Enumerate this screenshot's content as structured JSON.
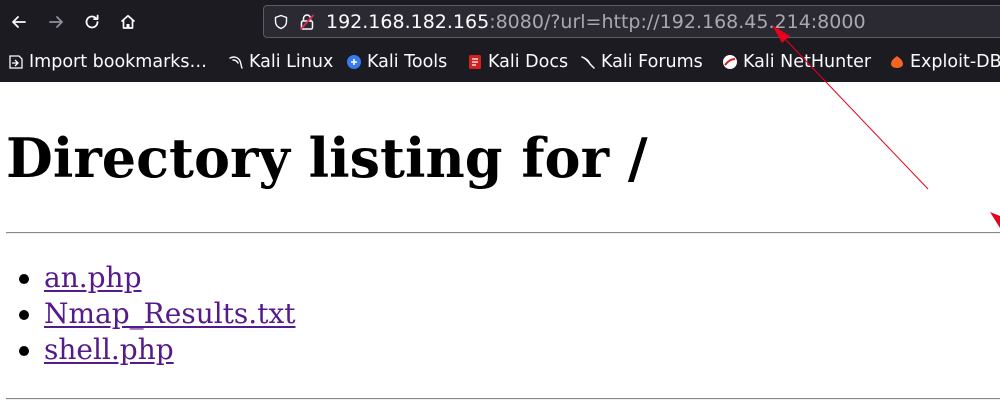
{
  "browser": {
    "url": {
      "host": "192.168.182.165",
      "rest": ":8080/?url=http://192.168.45.214:8000"
    },
    "bookmarks": [
      {
        "label": "Import bookmarks…",
        "icon": "import-icon"
      },
      {
        "label": "Kali Linux",
        "icon": "kali-dragon-icon"
      },
      {
        "label": "Kali Tools",
        "icon": "kali-tools-icon"
      },
      {
        "label": "Kali Docs",
        "icon": "kali-docs-icon"
      },
      {
        "label": "Kali Forums",
        "icon": "kali-forums-icon"
      },
      {
        "label": "Kali NetHunter",
        "icon": "kali-nethunter-icon"
      },
      {
        "label": "Exploit-DB",
        "icon": "exploit-db-icon"
      }
    ]
  },
  "page": {
    "heading": "Directory listing for /",
    "files": [
      "an.php",
      "Nmap_Results.txt",
      "shell.php"
    ]
  },
  "colors": {
    "toolbar_bg": "#1c1b22",
    "urlbar_bg": "#2b2a33",
    "link_visited": "#551a8b",
    "annotation_arrow": "#e8001c"
  }
}
